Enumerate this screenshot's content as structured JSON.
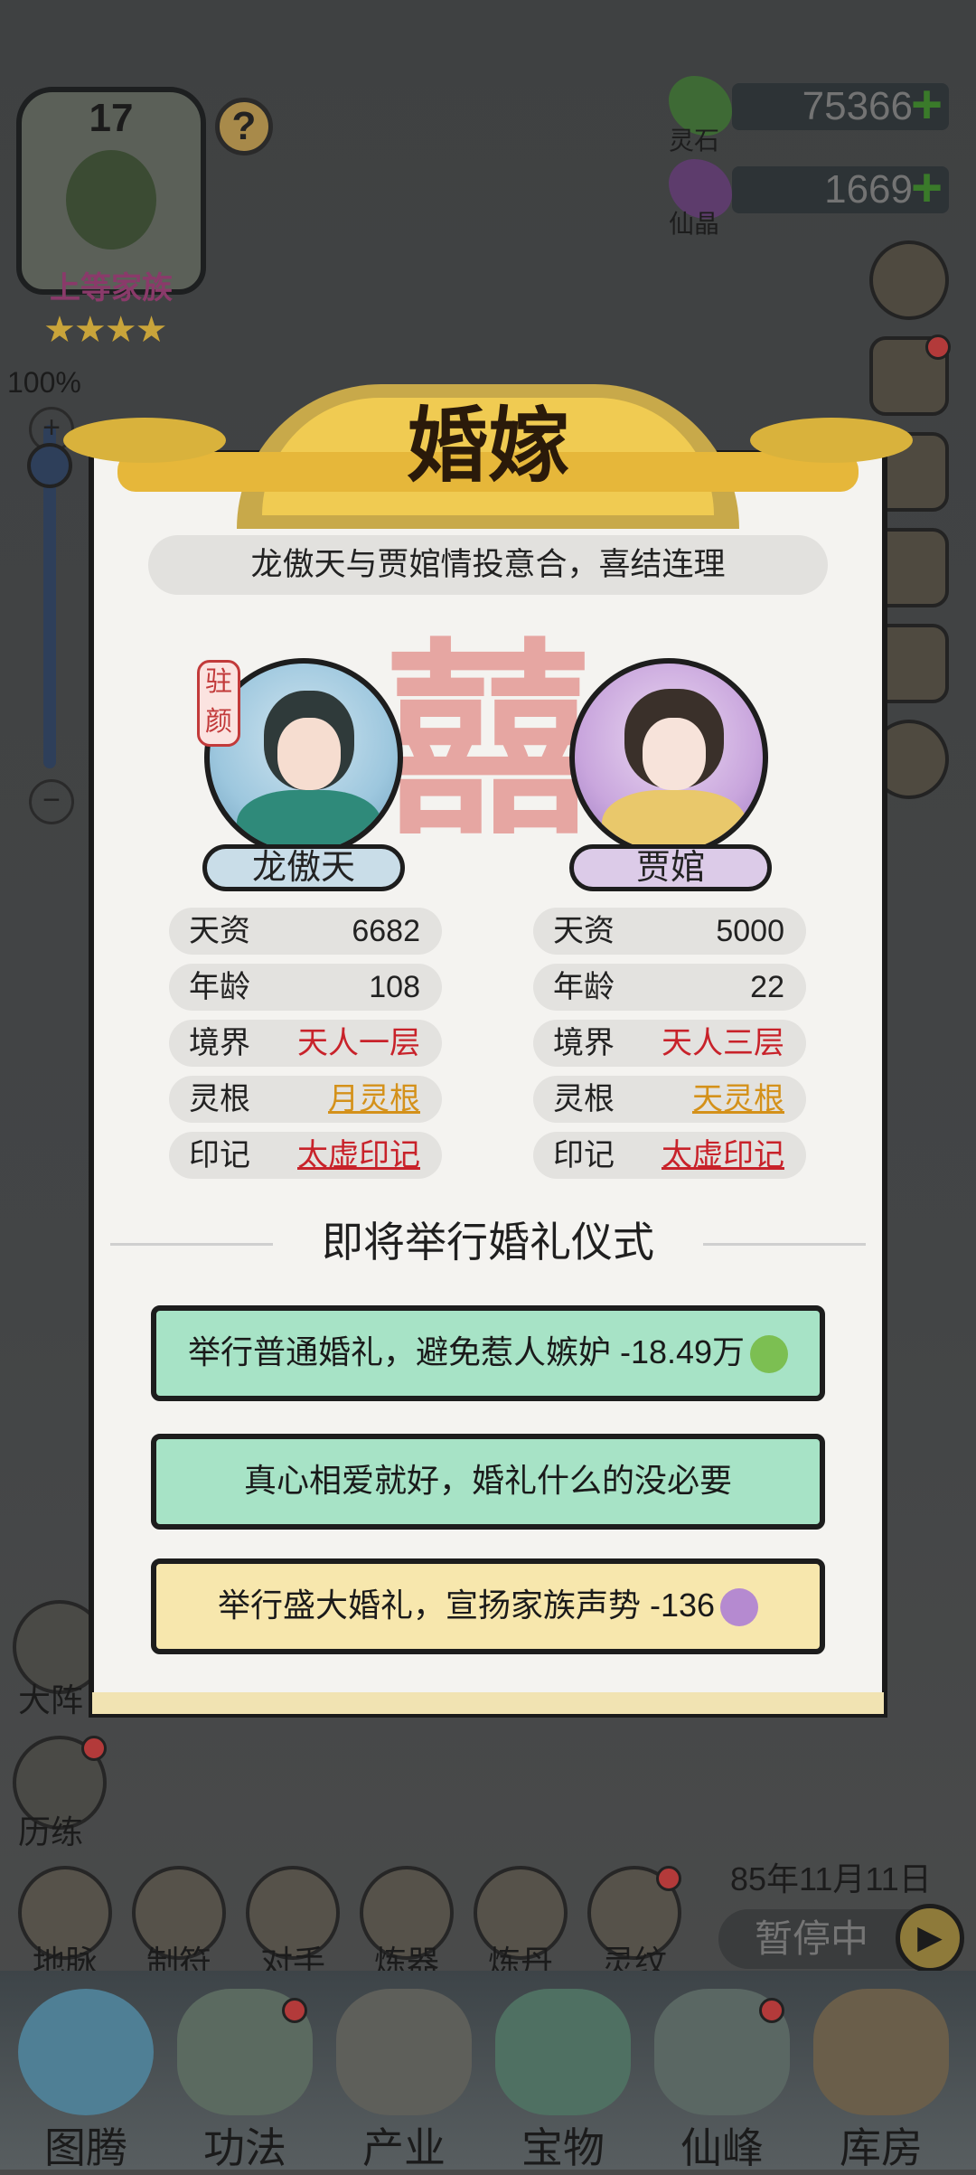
{
  "clan": {
    "level": "17",
    "rank": "上等家族",
    "stars": "★★★★",
    "help": "?"
  },
  "zoom": {
    "value": "100%",
    "plus": "+",
    "minus": "−"
  },
  "resources": [
    {
      "label": "灵石",
      "value": "75366",
      "color": "#3e6a35"
    },
    {
      "label": "仙晶",
      "value": "1669",
      "color": "#5d3c6c"
    }
  ],
  "modal": {
    "title": "婚嫁",
    "subtitle": "龙傲天与贾婠情投意合，喜结连理",
    "xi": "囍",
    "left": {
      "name": "龙傲天",
      "seal": "驻颜",
      "stats": [
        {
          "k": "天资",
          "v": "6682"
        },
        {
          "k": "年龄",
          "v": "108"
        },
        {
          "k": "境界",
          "v": "天人一层"
        },
        {
          "k": "灵根",
          "v": "月灵根"
        },
        {
          "k": "印记",
          "v": "太虚印记"
        }
      ]
    },
    "right": {
      "name": "贾婠",
      "stats": [
        {
          "k": "天资",
          "v": "5000"
        },
        {
          "k": "年龄",
          "v": "22"
        },
        {
          "k": "境界",
          "v": "天人三层"
        },
        {
          "k": "灵根",
          "v": "天灵根"
        },
        {
          "k": "印记",
          "v": "太虚印记"
        }
      ]
    },
    "section_title": "即将举行婚礼仪式",
    "options": [
      {
        "label": "举行普通婚礼，避免惹人嫉妒 -18.49万",
        "icon": "spirit-stone-icon"
      },
      {
        "label": "真心相爱就好，婚礼什么的没必要"
      },
      {
        "label": "举行盛大婚礼，宣扬家族声势 -136",
        "icon": "immortal-crystal-icon"
      }
    ]
  },
  "time": {
    "date": "85年11月11日",
    "status": "暂停中",
    "play": "▶"
  },
  "left_menu": [
    {
      "label": "大阵"
    },
    {
      "label": "历练"
    }
  ],
  "tools": [
    "地脉",
    "制符",
    "对手",
    "炼器",
    "炼丹",
    "灵纹"
  ],
  "dock": [
    "图腾",
    "功法",
    "产业",
    "宝物",
    "仙峰",
    "库房"
  ]
}
